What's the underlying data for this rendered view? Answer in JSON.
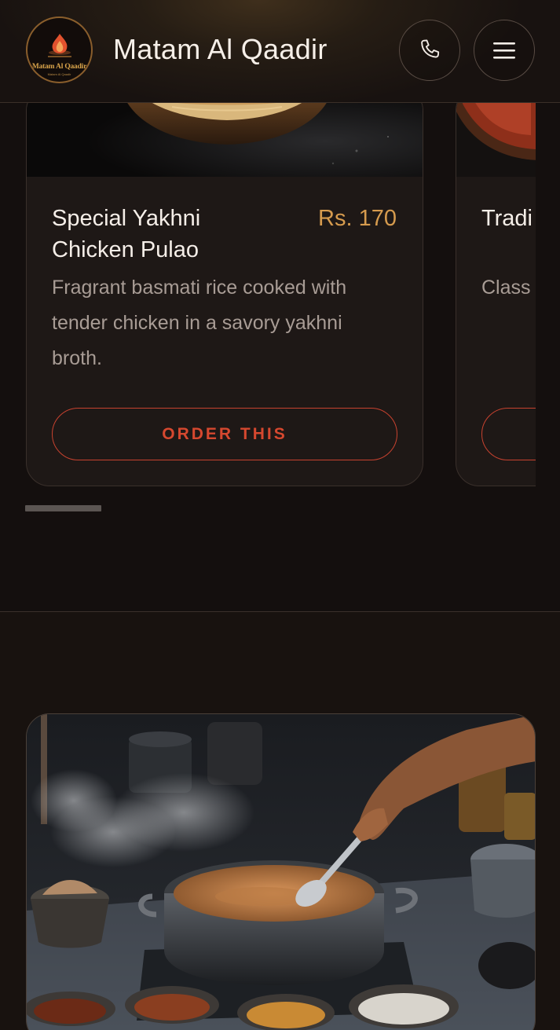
{
  "header": {
    "brand_name": "Matam Al Qaadir",
    "logo_text": "Matam Al Qaadir",
    "logo_subtext": "Matam Al Qaadir",
    "call_icon": "phone-icon",
    "menu_icon": "hamburger-menu-icon"
  },
  "menu_items": [
    {
      "name": "Special Yakhni Chicken Pulao",
      "price": "Rs. 170",
      "description": "Fragrant basmati rice cooked with tender chicken in a savory yakhni broth.",
      "cta": "ORDER THIS"
    },
    {
      "name": "Tradi Gosh",
      "price": "",
      "description": "Class tende traditi",
      "cta": ""
    }
  ],
  "colors": {
    "background": "#140f0e",
    "card": "#1e1816",
    "price": "#d69b4e",
    "accent": "#c7422f"
  }
}
